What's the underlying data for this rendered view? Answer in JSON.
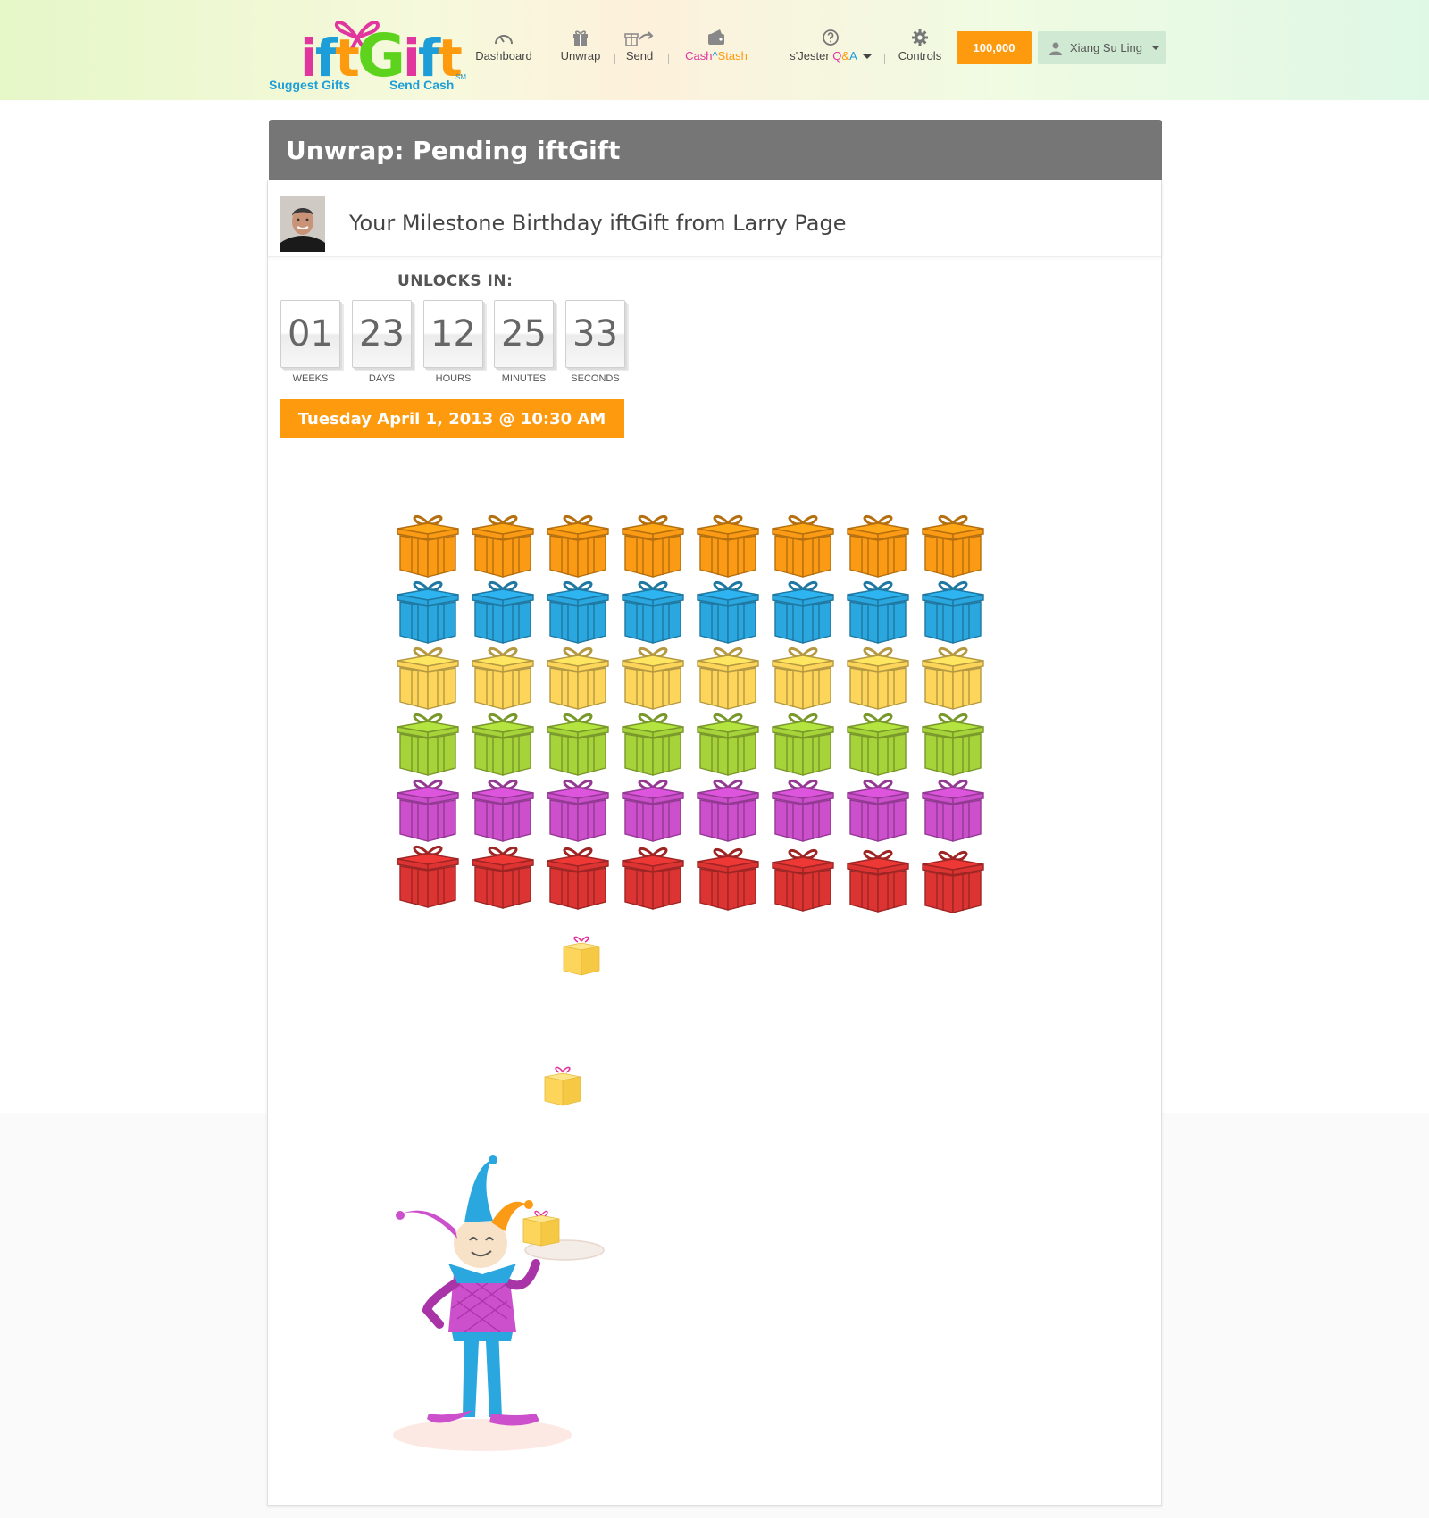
{
  "brand": {
    "logo_text": "iftGift",
    "tag_left": "Suggest Gifts",
    "tag_right": "Send Cash",
    "sm": "SM"
  },
  "nav": {
    "dashboard": "Dashboard",
    "unwrap": "Unwrap",
    "send": "Send",
    "cash_part": "Cash",
    "caret_part": "^",
    "stash_part": "Stash",
    "jester_part": "s'Jester ",
    "qa_q": "Q",
    "qa_amp": "&",
    "qa_a": "A",
    "controls": "Controls"
  },
  "balance": "100,000",
  "user": {
    "name": "Xiang Su Ling"
  },
  "page_title": "Unwrap: Pending iftGift",
  "gift": {
    "title": "Your Milestone Birthday iftGift from Larry Page",
    "unlocks_label": "UNLOCKS IN:",
    "countdown": [
      {
        "value": "01",
        "label": "WEEKS"
      },
      {
        "value": "23",
        "label": "DAYS"
      },
      {
        "value": "12",
        "label": "HOURS"
      },
      {
        "value": "25",
        "label": "MINUTES"
      },
      {
        "value": "33",
        "label": "SECONDS"
      }
    ],
    "unlock_date": "Tuesday April 1, 2013 @ 10:30 AM"
  },
  "colors": {
    "orange": "#fd9a0e",
    "gift_rows": [
      "#fb9a14",
      "#2aa7df",
      "#fcd55a",
      "#a6d33a",
      "#cc4fcc",
      "#dc3432"
    ],
    "small_gift": "#fcd55a"
  },
  "icons": {
    "dashboard": "speedometer-icon",
    "unwrap": "gift-box-icon",
    "send": "gift-send-icon",
    "stash": "wallet-icon",
    "qa": "question-circle-icon",
    "controls": "gear-icon",
    "user": "user-icon"
  }
}
